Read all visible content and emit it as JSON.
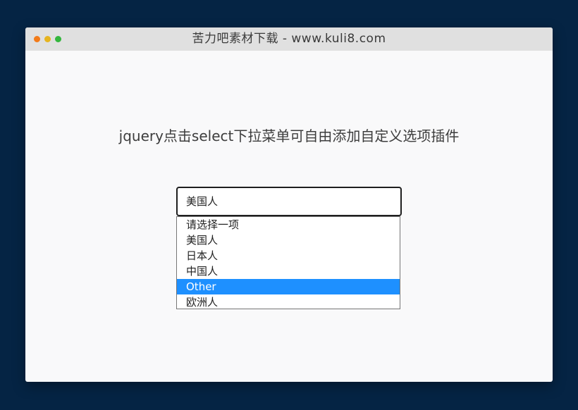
{
  "window": {
    "title": "苦力吧素材下载 - www.kuli8.com",
    "traffic_lights": [
      {
        "name": "close",
        "color": "#f27b19"
      },
      {
        "name": "minimize",
        "color": "#e6b41f"
      },
      {
        "name": "zoom",
        "color": "#33b63d"
      }
    ]
  },
  "page": {
    "heading": "jquery点击select下拉菜单可自由添加自定义选项插件"
  },
  "select": {
    "current_value": "美国人",
    "options": [
      {
        "label": "请选择一项",
        "highlighted": false
      },
      {
        "label": "美国人",
        "highlighted": false
      },
      {
        "label": "日本人",
        "highlighted": false
      },
      {
        "label": "中国人",
        "highlighted": false
      },
      {
        "label": "Other",
        "highlighted": true
      },
      {
        "label": "欧洲人",
        "highlighted": false
      }
    ],
    "highlight_color": "#1e90ff"
  }
}
